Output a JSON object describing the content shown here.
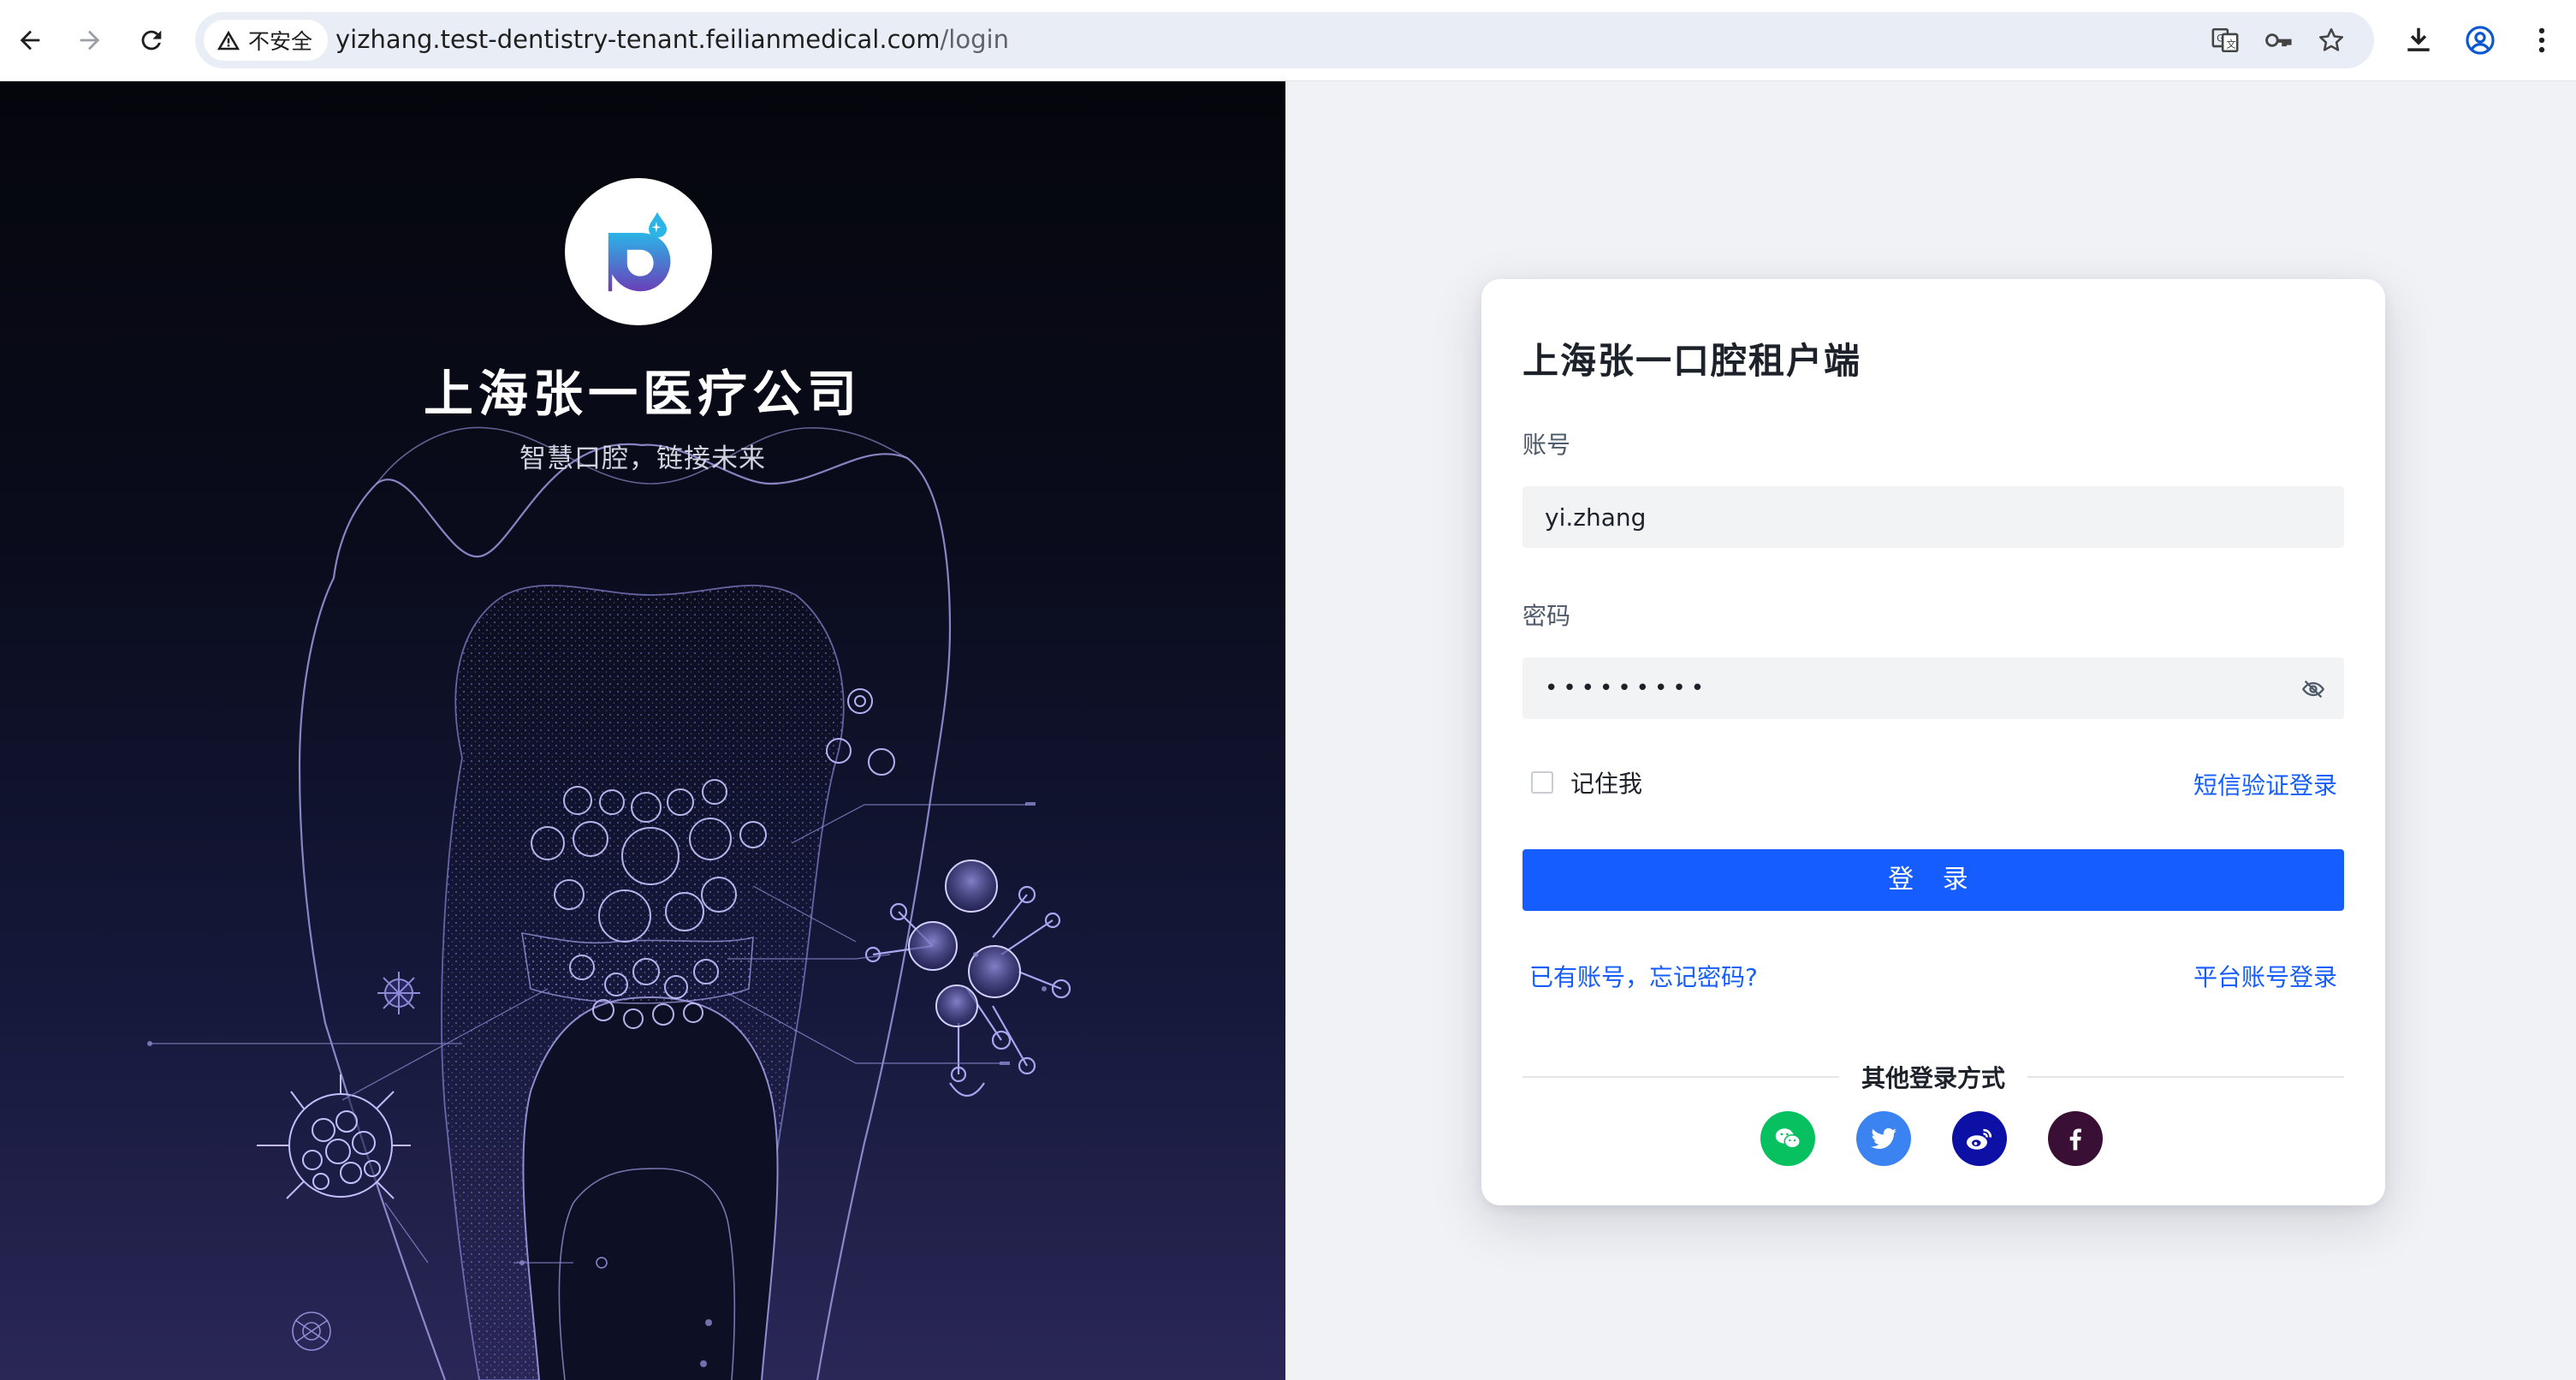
{
  "browser": {
    "security_label": "不安全",
    "url_host": "yizhang.test-dentistry-tenant.feilianmedical.com",
    "url_path": "/login",
    "icons": [
      "back-icon",
      "forward-icon",
      "reload-icon",
      "warning-icon",
      "translate-icon",
      "key-icon",
      "star-icon",
      "download-icon",
      "profile-icon",
      "menu-icon"
    ]
  },
  "hero": {
    "company_name": "上海张一医疗公司",
    "slogan": "智慧口腔，链接未来",
    "logo_icon": "tooth-logo-icon"
  },
  "login": {
    "title": "上海张一口腔租户端",
    "account_label": "账号",
    "account_value": "yi.zhang",
    "password_label": "密码",
    "password_value": "•••••••••",
    "remember_label": "记住我",
    "remember_checked": false,
    "sms_login_link": "短信验证登录",
    "submit_label": "登 录",
    "forgot_link": "已有账号，忘记密码?",
    "platform_login_link": "平台账号登录",
    "other_methods_title": "其他登录方式",
    "social": [
      {
        "name": "wechat",
        "icon": "wechat-icon",
        "color": "#07c160"
      },
      {
        "name": "twitter",
        "icon": "twitter-icon",
        "color": "#3a83f1"
      },
      {
        "name": "weibo",
        "icon": "weibo-icon",
        "color": "#0c10a5"
      },
      {
        "name": "facebook",
        "icon": "facebook-icon",
        "color": "#3a0f35"
      }
    ],
    "accent_color": "#165dff"
  }
}
